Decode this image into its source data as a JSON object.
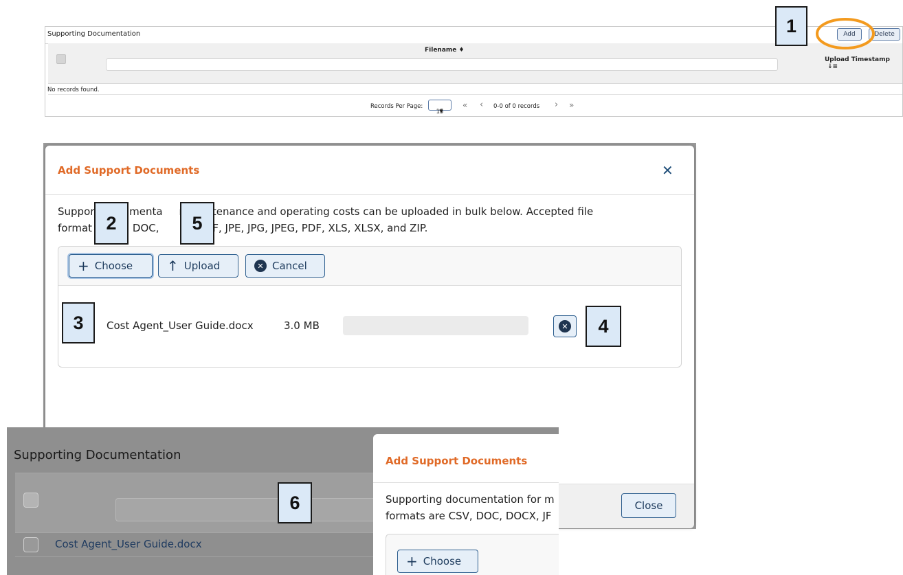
{
  "panel1": {
    "title": "Supporting Documentation",
    "add_label": "Add",
    "delete_label": "Delete",
    "col_filename": "Filename",
    "col_filename_sort_icon": "sort-both-icon",
    "col_timestamp": "Upload Timestamp",
    "col_timestamp_sort_icon": "sort-desc-icon",
    "empty_text": "No records found.",
    "pager": {
      "rpp_label": "Records Per Page:",
      "rpp_value": "15",
      "first": "«",
      "prev": "‹",
      "status": "0-0 of 0 records",
      "next": "›",
      "last": "»"
    },
    "highlight_color": "#f39a1e"
  },
  "callouts": [
    "1",
    "2",
    "3",
    "4",
    "5",
    "6"
  ],
  "dialog": {
    "title": "Add Support Documents",
    "close_symbol": "✕",
    "desc_line1": "Suppor     ocumenta     r maintenance and operating costs can be uploaded in bulk below. Accepted file",
    "desc_line2": "format    CSV, DOC,       JFIF, JIF, JPE, JPG, JPEG, PDF, XLS, XLSX, and ZIP.",
    "choose_label": "Choose",
    "upload_label": "Upload",
    "cancel_label": "Cancel",
    "file": {
      "name": "Cost Agent_User Guide.docx",
      "size": "3.0 MB",
      "progress": 0
    },
    "close_button": "Close",
    "title_color": "#e06a27"
  },
  "panel3": {
    "title": "Supporting Documentation",
    "row_file": "Cost Agent_User Guide.docx",
    "mini_title": "Add Support Documents",
    "mini_desc_line1": "Supporting documentation for m",
    "mini_desc_line2": "formats are CSV, DOC, DOCX, JF",
    "mini_choose": "Choose"
  }
}
